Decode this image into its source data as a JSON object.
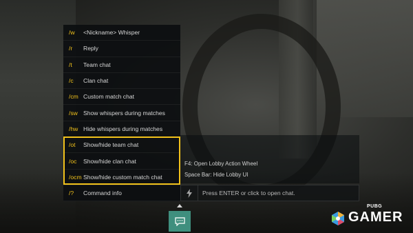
{
  "commands": [
    {
      "code": "/w",
      "desc": "<Nickname> Whisper"
    },
    {
      "code": "/r",
      "desc": "Reply"
    },
    {
      "code": "/t",
      "desc": "Team chat"
    },
    {
      "code": "/c",
      "desc": "Clan chat"
    },
    {
      "code": "/cm",
      "desc": "Custom match chat"
    },
    {
      "code": "/sw",
      "desc": "Show whispers during matches"
    },
    {
      "code": "/hw",
      "desc": "Hide whispers during matches"
    },
    {
      "code": "/ot",
      "desc": "Show/hide team chat"
    },
    {
      "code": "/oc",
      "desc": "Show/hide clan chat"
    },
    {
      "code": "/ocm",
      "desc": "Show/hide custom match chat"
    },
    {
      "code": "/?",
      "desc": "Command info"
    }
  ],
  "hints": {
    "action_wheel": "F4: Open Lobby Action Wheel",
    "hide_ui": "Space Bar: Hide Lobby UI"
  },
  "chat": {
    "placeholder": "Press ENTER or click to open chat."
  },
  "logo": {
    "brand_top": "PUBG",
    "brand_main": "GAMER"
  },
  "colors": {
    "accent": "#f2c21b",
    "chat_button": "#3f8f7e"
  },
  "icons": {
    "bolt": "lightning-bolt-icon",
    "chat": "chat-bubble-icon",
    "caret": "caret-up-icon"
  }
}
